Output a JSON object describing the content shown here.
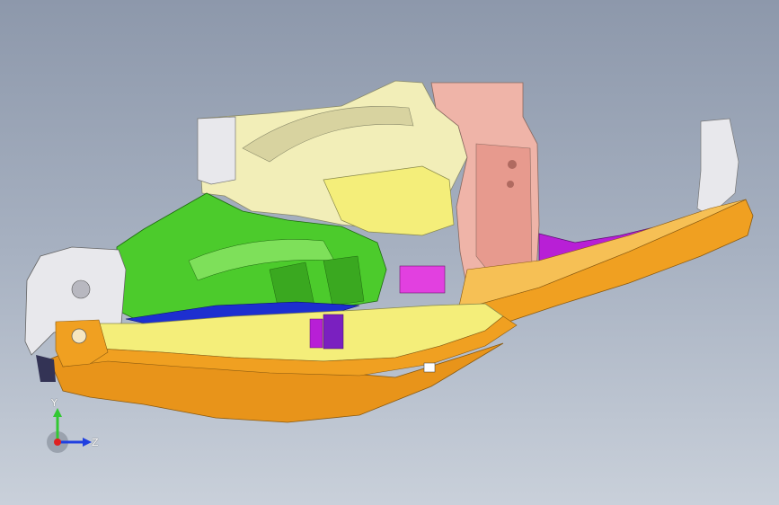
{
  "viewport": {
    "background_top": "#8d98ab",
    "background_bottom": "#c9d0da"
  },
  "model": {
    "colors": {
      "orange_rail": "#f0a021",
      "orange_dark": "#c97410",
      "yellow_panel": "#f4ee7a",
      "cream_panel": "#f2eeb8",
      "pink_panel": "#efb4a8",
      "green_panel": "#4ccb2c",
      "blue_panel": "#1d2fd0",
      "magenta_panel": "#b81fd6",
      "white_panel": "#e8e8ec"
    }
  },
  "triad": {
    "y_label": "Y",
    "z_label": "Z",
    "y_color": "#32c832",
    "z_color": "#2040e0",
    "x_color": "#e02020"
  }
}
